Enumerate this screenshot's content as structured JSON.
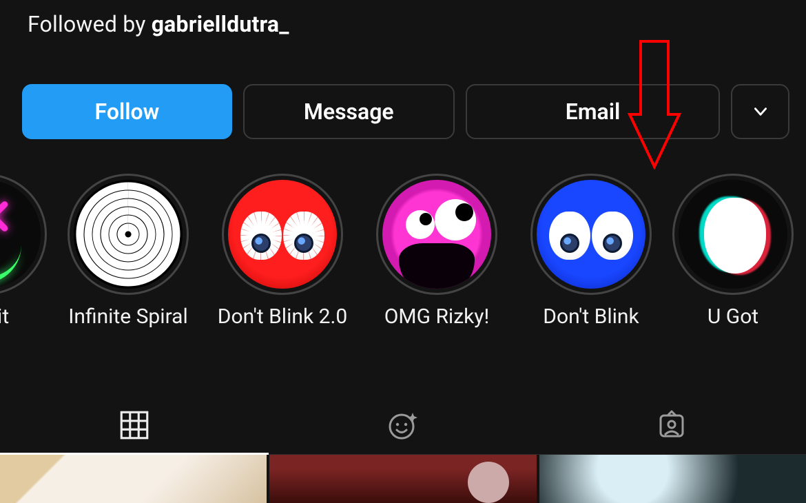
{
  "followed_by_prefix": "Followed by ",
  "followed_by_name": "gabrielldutra_",
  "buttons": {
    "follow": "Follow",
    "message": "Message",
    "email": "Email"
  },
  "highlights": [
    {
      "label": "erx-it"
    },
    {
      "label": "Infinite Spiral"
    },
    {
      "label": "Don't Blink 2.0"
    },
    {
      "label": "OMG Rizky!"
    },
    {
      "label": "Don't Blink"
    },
    {
      "label": "U Got"
    }
  ],
  "icons": {
    "more": "chevron-down-icon",
    "tab_grid": "grid-icon",
    "tab_effects": "effects-sparkle-face-icon",
    "tab_tagged": "tagged-user-icon"
  },
  "colors": {
    "primary_button": "#229cf5",
    "annotation": "#ff0000",
    "highlight_red": "#e31313",
    "highlight_blue": "#0a2cf3",
    "highlight_magenta": "#ff35d3"
  }
}
